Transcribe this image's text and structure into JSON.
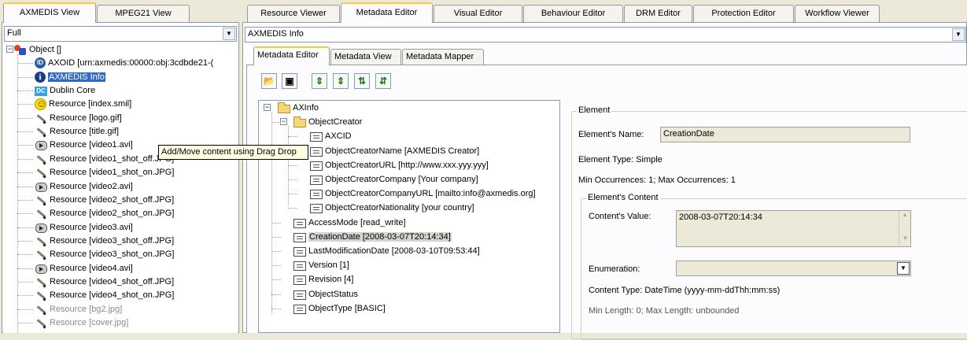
{
  "left_tabs": [
    "AXMEDIS View",
    "MPEG21 View"
  ],
  "left_combo": "Full",
  "tree": [
    {
      "label": "Object []",
      "icon": "object-icon"
    },
    {
      "label": "AXOID [urn:axmedis:00000:obj:3cdbde21-(",
      "icon": "id-icon"
    },
    {
      "label": "AXMEDIS Info",
      "icon": "info-icon"
    },
    {
      "label": "Dublin Core",
      "icon": "dc-icon"
    },
    {
      "label": "Resource [index.smil]",
      "icon": "smiley-icon"
    },
    {
      "label": "Resource [logo.gif]",
      "icon": "pen-icon"
    },
    {
      "label": "Resource [title.gif]",
      "icon": "pen-icon"
    },
    {
      "label": "Resource [video1.avi]",
      "icon": "video-icon"
    },
    {
      "label": "Resource [video1_shot_off.JPG]",
      "icon": "pen-icon"
    },
    {
      "label": "Resource [video1_shot_on.JPG]",
      "icon": "pen-icon"
    },
    {
      "label": "Resource [video2.avi]",
      "icon": "video-icon"
    },
    {
      "label": "Resource [video2_shot_off.JPG]",
      "icon": "pen-icon"
    },
    {
      "label": "Resource [video2_shot_on.JPG]",
      "icon": "pen-icon"
    },
    {
      "label": "Resource [video3.avi]",
      "icon": "video-icon"
    },
    {
      "label": "Resource [video3_shot_off.JPG]",
      "icon": "pen-icon"
    },
    {
      "label": "Resource [video3_shot_on.JPG]",
      "icon": "pen-icon"
    },
    {
      "label": "Resource [video4.avi]",
      "icon": "video-icon"
    },
    {
      "label": "Resource [video4_shot_off.JPG]",
      "icon": "pen-icon"
    },
    {
      "label": "Resource [video4_shot_on.JPG]",
      "icon": "pen-icon"
    },
    {
      "label": "Resource [bg2.jpg]",
      "icon": "pen-icon"
    },
    {
      "label": "Resource [cover.jpg]",
      "icon": "pen-icon"
    }
  ],
  "tooltip": "Add/Move content using Drag Drop",
  "main_tabs": [
    "Resource Viewer",
    "Metadata Editor",
    "Visual Editor",
    "Behaviour Editor",
    "DRM Editor",
    "Protection Editor",
    "Workflow Viewer"
  ],
  "main_combo": "AXMEDIS Info",
  "sub_tabs": [
    "Metadata Editor",
    "Metadata View",
    "Metadata Mapper"
  ],
  "toolbar_icons": [
    "open-folder-icon",
    "save-icon",
    "move-up-icon",
    "move-down-icon",
    "expand-icon",
    "collapse-icon"
  ],
  "meta_tree": [
    {
      "label": "AXInfo",
      "icon": "folder-open-icon"
    },
    {
      "label": "ObjectCreator",
      "icon": "folder-open-icon"
    },
    {
      "label": "AXCID",
      "icon": "document-icon"
    },
    {
      "label": "ObjectCreatorName [AXMEDIS Creator]",
      "icon": "document-icon"
    },
    {
      "label": "ObjectCreatorURL [http://www.xxx.yyy.yyy]",
      "icon": "document-icon"
    },
    {
      "label": "ObjectCreatorCompany [Your company]",
      "icon": "document-icon"
    },
    {
      "label": "ObjectCreatorCompanyURL [mailto:info@axmedis.org]",
      "icon": "document-icon"
    },
    {
      "label": "ObjectCreatorNationality [your country]",
      "icon": "document-icon"
    },
    {
      "label": "AccessMode [read_write]",
      "icon": "document-icon"
    },
    {
      "label": "CreationDate [2008-03-07T20:14:34]",
      "icon": "document-icon"
    },
    {
      "label": "LastModificationDate [2008-03-10T09:53:44]",
      "icon": "document-icon"
    },
    {
      "label": "Version [1]",
      "icon": "document-icon"
    },
    {
      "label": "Revision [4]",
      "icon": "document-icon"
    },
    {
      "label": "ObjectStatus",
      "icon": "document-icon"
    },
    {
      "label": "ObjectType [BASIC]",
      "icon": "document-icon"
    }
  ],
  "element": {
    "legend": "Element",
    "name_label": "Element's Name:",
    "name_value": "CreationDate",
    "type_text": "Element Type: Simple",
    "occurrences_text": "Min Occurrences: 1; Max Occurrences: 1",
    "content_legend": "Element's Content",
    "value_label": "Content's Value:",
    "value": "2008-03-07T20:14:34",
    "enum_label": "Enumeration:",
    "enum_value": "",
    "content_type": "Content Type: DateTime (yyyy-mm-ddThh:mm:ss)",
    "length_text": "Min Length: 0; Max Length: unbounded"
  }
}
